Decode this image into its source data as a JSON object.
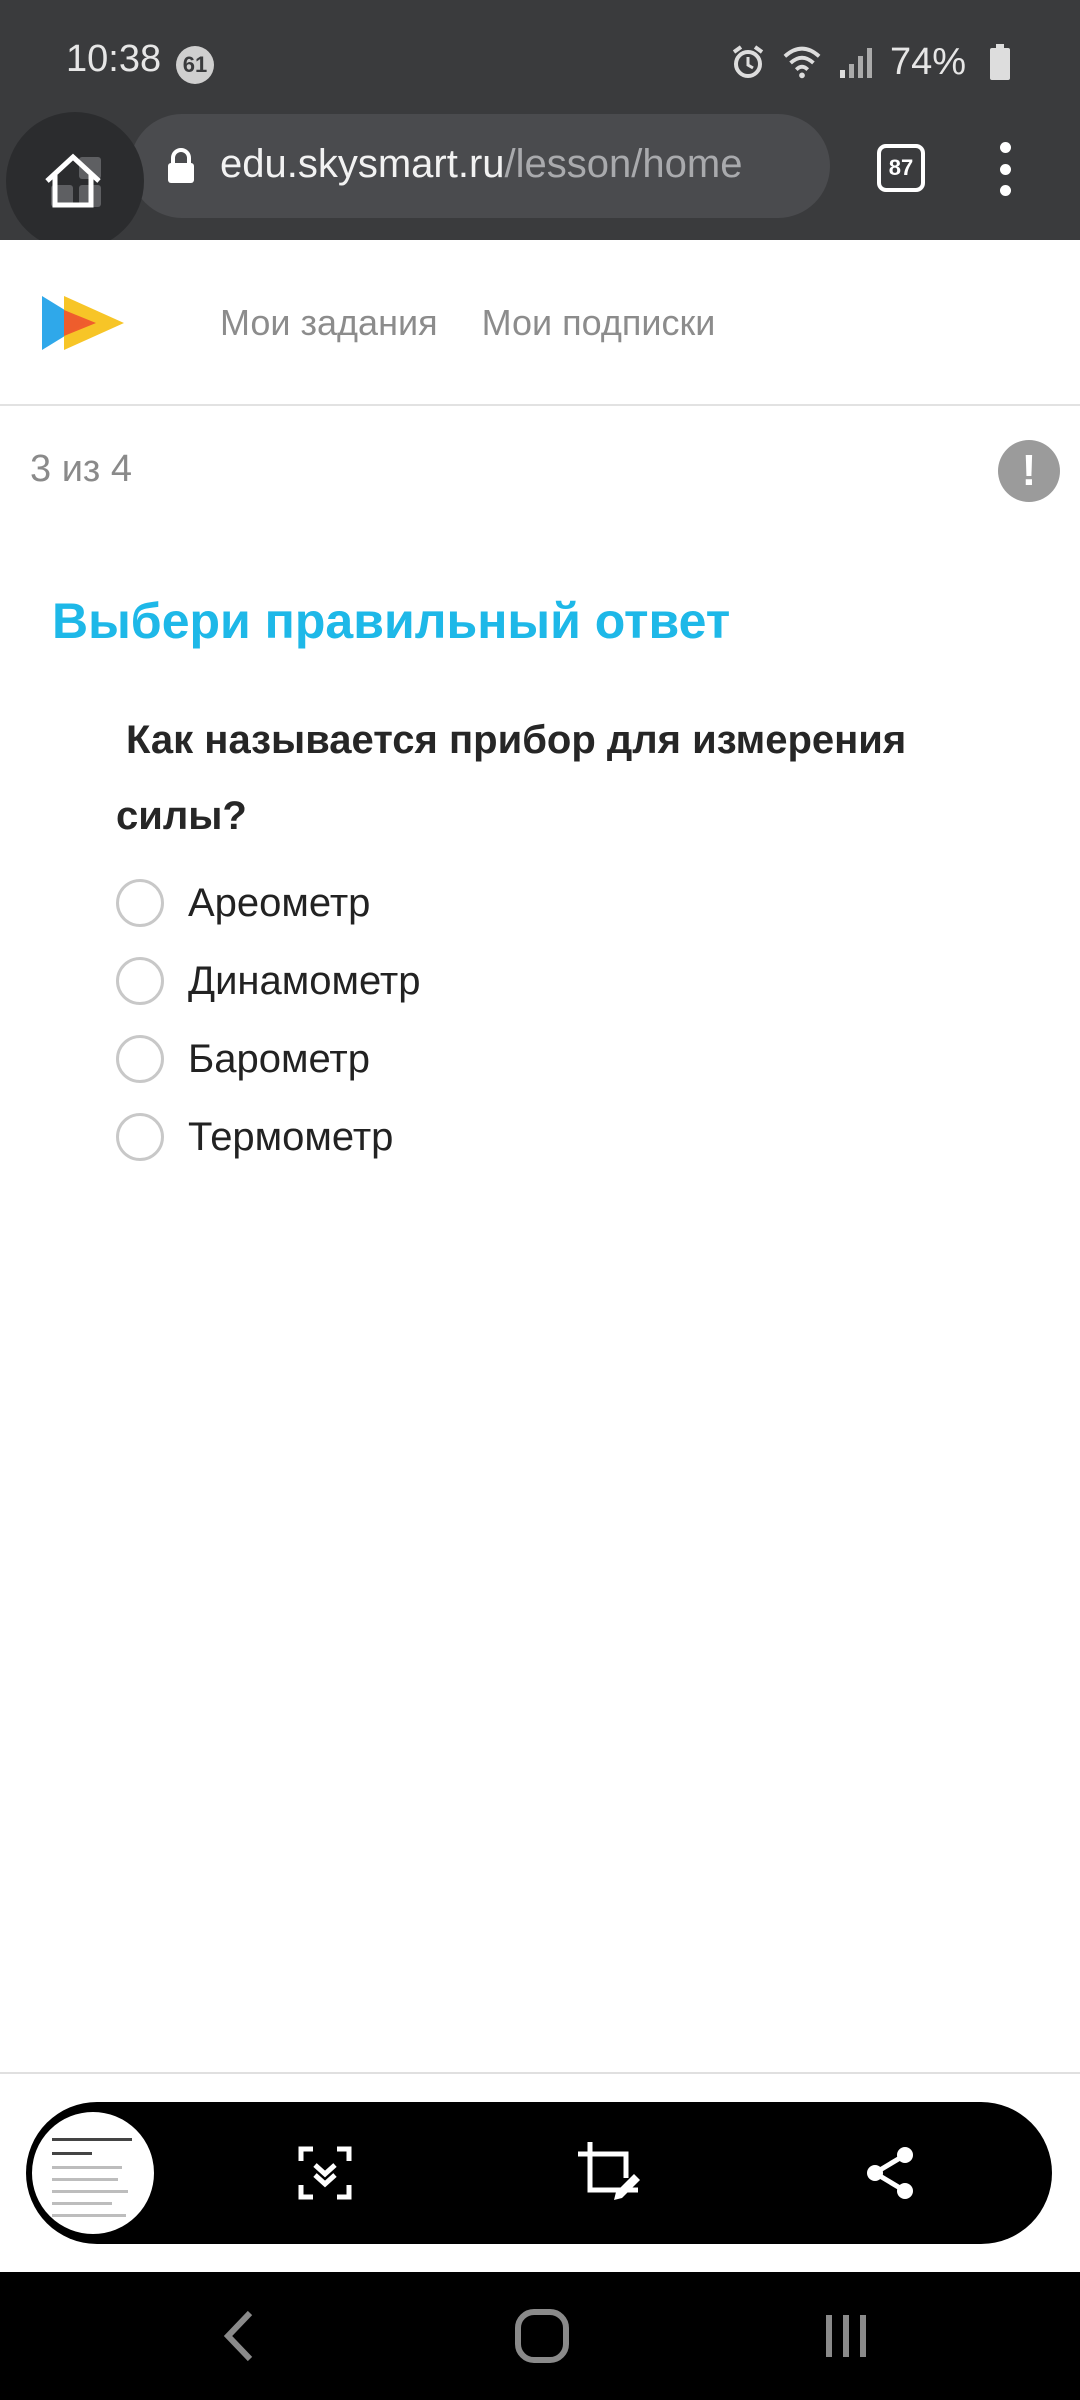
{
  "status_bar": {
    "time": "10:38",
    "notification_count": "61",
    "battery": "74%"
  },
  "browser": {
    "url_host": "edu.skysmart.ru",
    "url_path": "/lesson/home",
    "tab_count": "87"
  },
  "site": {
    "nav": [
      "Мои задания",
      "Мои подписки"
    ],
    "logo_colors": [
      "#2fa8ea",
      "#f7c21b",
      "#ef4b2f"
    ]
  },
  "quiz": {
    "progress": "3 из 4",
    "report_symbol": "!",
    "task_title": "Выбери правильный ответ",
    "question": "Как называется прибор для измерения силы?",
    "options": [
      "Ареометр",
      "Динамометр",
      "Барометр",
      "Термометр"
    ]
  },
  "colors": {
    "accent": "#1eb8e8",
    "chrome_bg": "#3a3b3d"
  }
}
